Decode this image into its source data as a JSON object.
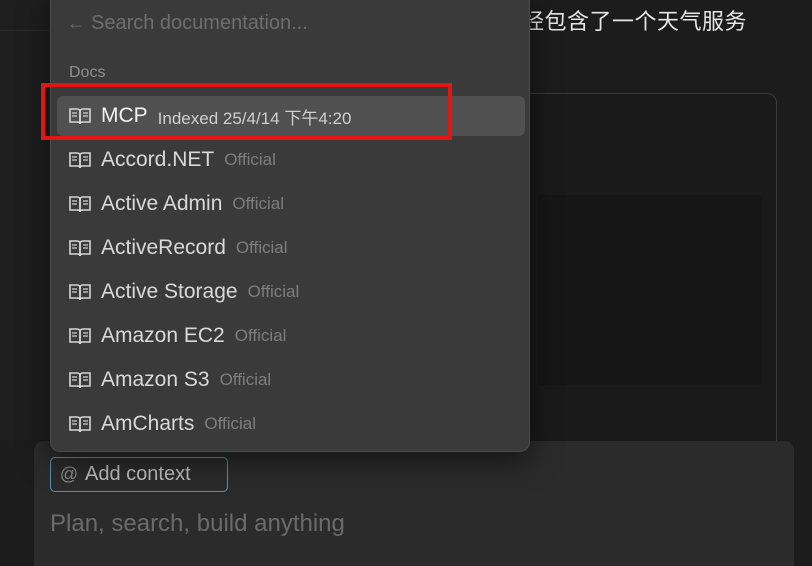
{
  "background": {
    "heading_text": "经包含了一个天气服务"
  },
  "composer": {
    "add_context_label": "Add context",
    "at_symbol": "@",
    "input_placeholder": "Plan, search, build anything"
  },
  "dropdown": {
    "search_placeholder": "Search documentation...",
    "back_icon": "←",
    "section_label": "Docs",
    "items": [
      {
        "name": "MCP",
        "meta": "Indexed 25/4/14 下午4:20",
        "selected": true
      },
      {
        "name": "Accord.NET",
        "meta": "Official",
        "selected": false
      },
      {
        "name": "Active Admin",
        "meta": "Official",
        "selected": false
      },
      {
        "name": "ActiveRecord",
        "meta": "Official",
        "selected": false
      },
      {
        "name": "Active Storage",
        "meta": "Official",
        "selected": false
      },
      {
        "name": "Amazon EC2",
        "meta": "Official",
        "selected": false
      },
      {
        "name": "Amazon S3",
        "meta": "Official",
        "selected": false
      },
      {
        "name": "AmCharts",
        "meta": "Official",
        "selected": false
      }
    ]
  },
  "colors": {
    "highlight": "#e01616",
    "selected_row": "#505050",
    "dropdown_bg": "#3a3a3a",
    "context_pill_border": "#5a8fb0"
  },
  "icons": {
    "item_icon": "book-open-icon",
    "search_back_icon": "arrow-left-icon",
    "context_icon": "at-sign-icon"
  }
}
